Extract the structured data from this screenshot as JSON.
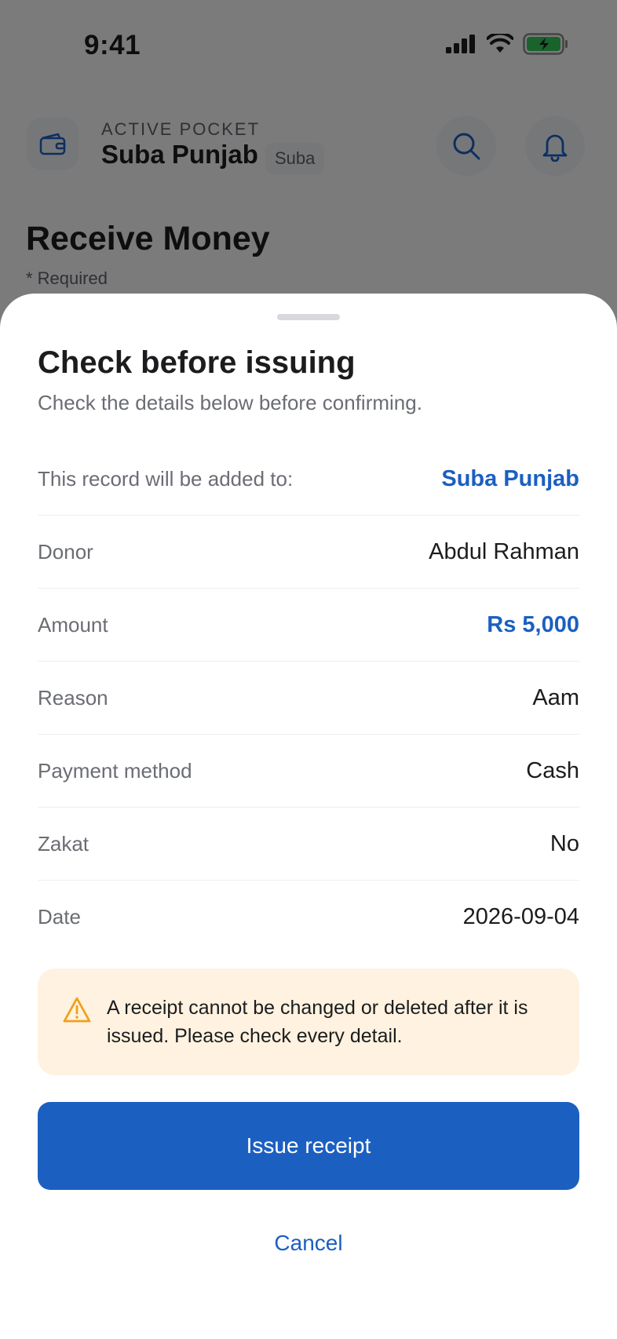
{
  "status_bar": {
    "time": "9:41",
    "icons": [
      "cellular-signal-icon",
      "wifi-icon",
      "battery-charging-icon"
    ]
  },
  "header": {
    "kicker": "ACTIVE POCKET",
    "pocket_name": "Suba Punjab",
    "badge": "Suba",
    "icons": [
      "wallet-icon",
      "search-icon",
      "bell-icon"
    ]
  },
  "page": {
    "title": "Receive Money",
    "required_note": "* Required"
  },
  "sheet": {
    "title": "Check before issuing",
    "subtitle": "Check the details below before confirming.",
    "rows": [
      {
        "label": "This record will be added to:",
        "value": "Suba Punjab",
        "accent": true
      },
      {
        "label": "Donor",
        "value": "Abdul Rahman",
        "accent": false
      },
      {
        "label": "Amount",
        "value": "Rs 5,000",
        "accent": true
      },
      {
        "label": "Reason",
        "value": "Aam",
        "accent": false
      },
      {
        "label": "Payment method",
        "value": "Cash",
        "accent": false
      },
      {
        "label": "Zakat",
        "value": "No",
        "accent": false
      },
      {
        "label": "Date",
        "value": "2026-09-04",
        "accent": false
      }
    ],
    "warning": {
      "icon": "warning-triangle-icon",
      "text": "A receipt cannot be changed or deleted after it is issued. Please check every detail."
    },
    "primary_button": "Issue receipt",
    "secondary_button": "Cancel"
  },
  "colors": {
    "accent": "#1b5fc1",
    "warning_bg": "#fff2e0",
    "warning_icon": "#f0a01e",
    "battery_green": "#34c759"
  }
}
